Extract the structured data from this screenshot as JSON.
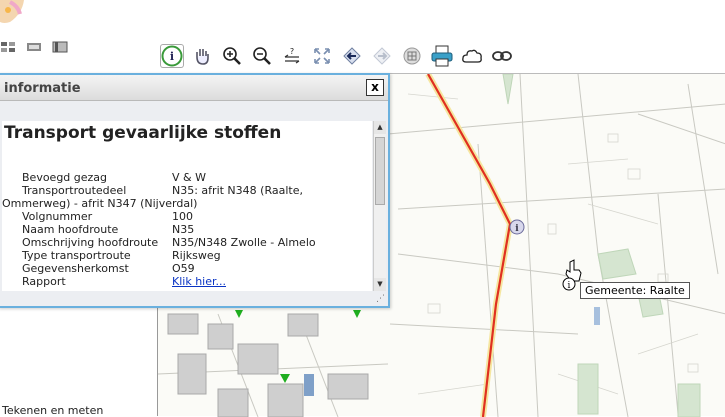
{
  "toolbar": {
    "icons": [
      "info-icon",
      "pan-hand-icon",
      "zoom-in-icon",
      "zoom-out-icon",
      "query-icon",
      "full-extent-icon",
      "back-icon",
      "forward-icon",
      "grid-icon",
      "print-icon",
      "cloud-icon",
      "link-chain-icon"
    ]
  },
  "panel": {
    "title": "informatie",
    "close_label": "x",
    "heading": "Transport gevaarlijke stoffen",
    "rows": [
      {
        "label": "Bevoegd gezag",
        "value": "V & W"
      },
      {
        "label": "Transportroutedeel",
        "value": "N35: afrit N348 (Raalte,",
        "continuation": "Ommerweg) - afrit N347 (Nijverdal)"
      },
      {
        "label": "Volgnummer",
        "value": "100"
      },
      {
        "label": "Naam hoofdroute",
        "value": "N35"
      },
      {
        "label": "Omschrijving hoofdroute",
        "value": "N35/N348 Zwolle - Almelo"
      },
      {
        "label": "Type transportroute",
        "value": "Rijksweg"
      },
      {
        "label": "Gegevensherkomst",
        "value": "O59"
      },
      {
        "label": "Rapport",
        "value": "Klik hier..."
      }
    ]
  },
  "map": {
    "tooltip": "Gemeente: Raalte",
    "route_color": "#e03020"
  },
  "sidebar": {
    "bottom_link": "Tekenen en meten"
  }
}
